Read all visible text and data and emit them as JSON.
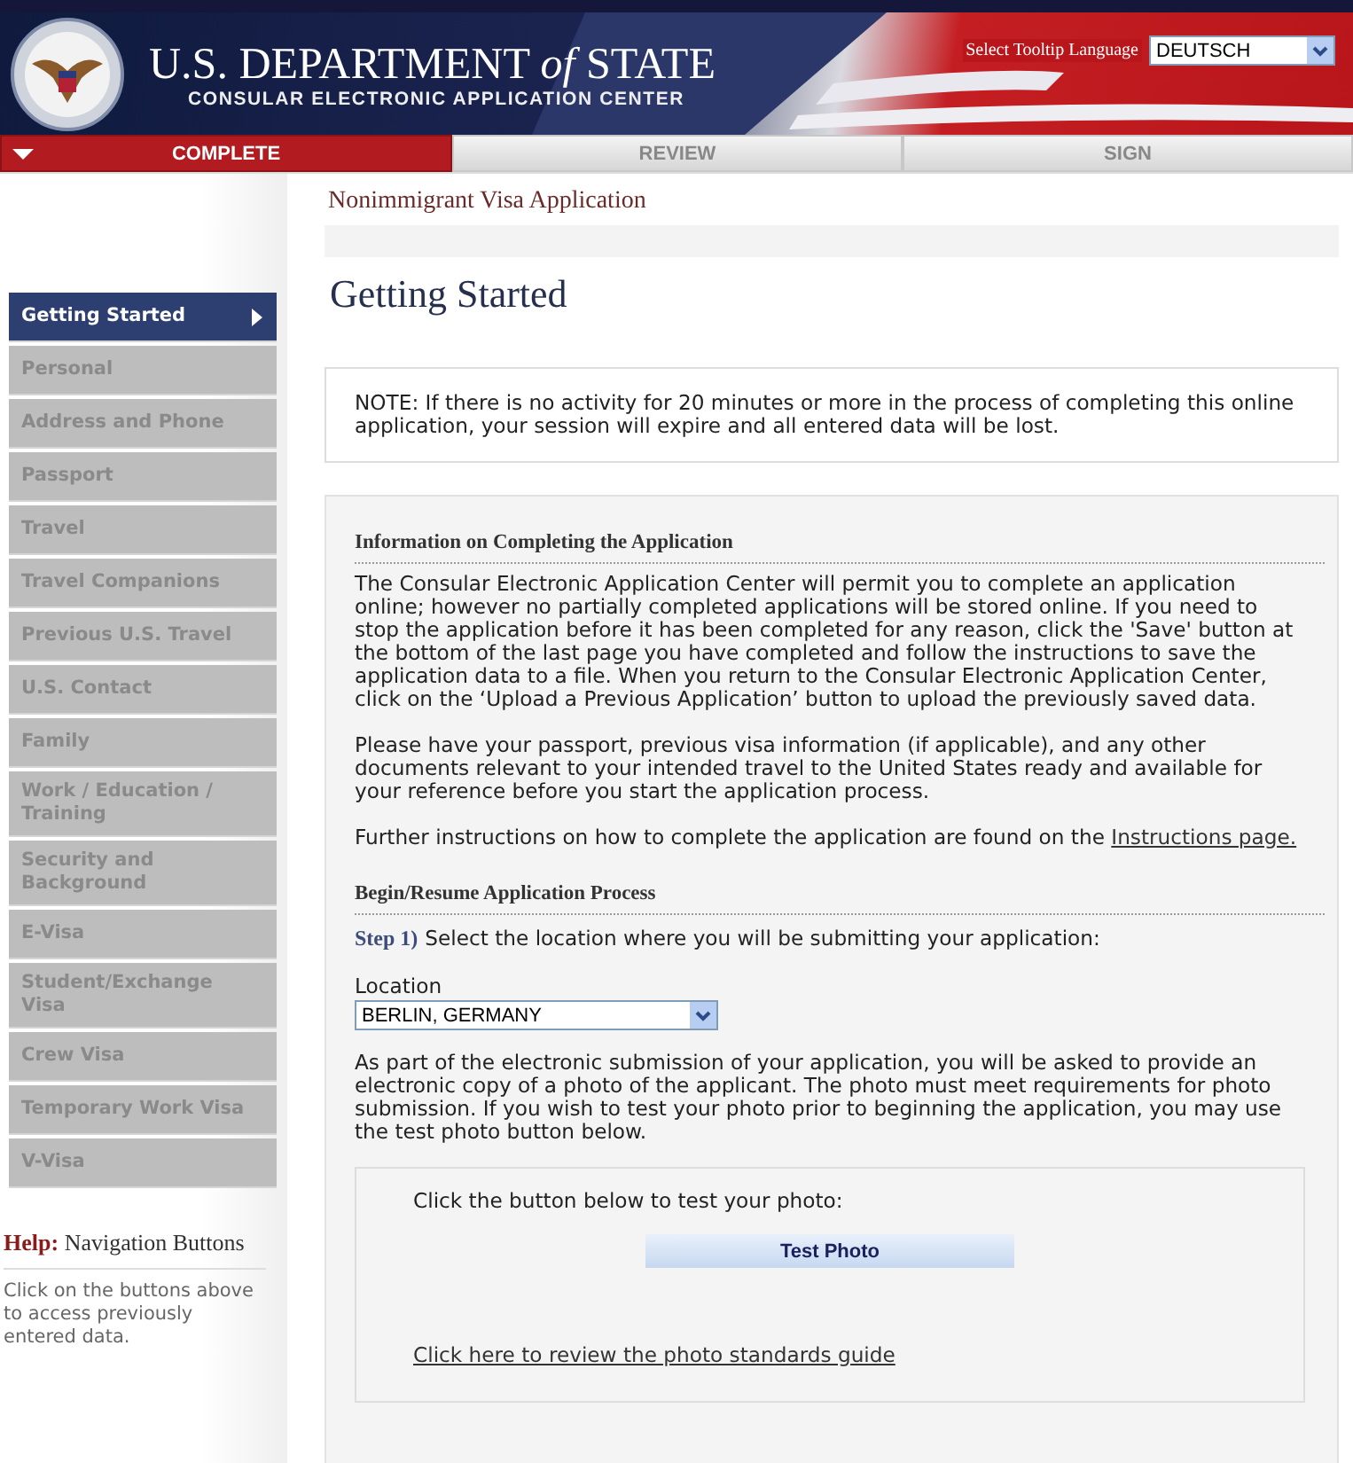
{
  "header": {
    "title": "U.S. DEPARTMENT *of* STATE",
    "subtitle": "CONSULAR ELECTRONIC APPLICATION CENTER",
    "tooltip_language": {
      "label": "Select Tooltip Language",
      "value": "DEUTSCH"
    }
  },
  "tabs": [
    {
      "label": "COMPLETE",
      "selected": true
    },
    {
      "label": "REVIEW",
      "selected": false
    },
    {
      "label": "SIGN",
      "selected": false
    }
  ],
  "sidebar": {
    "items": [
      {
        "label": "Getting Started",
        "selected": true
      },
      {
        "label": "Personal",
        "selected": false
      },
      {
        "label": "Address and Phone",
        "selected": false
      },
      {
        "label": "Passport",
        "selected": false
      },
      {
        "label": "Travel",
        "selected": false
      },
      {
        "label": "Travel Companions",
        "selected": false
      },
      {
        "label": "Previous U.S. Travel",
        "selected": false
      },
      {
        "label": "U.S. Contact",
        "selected": false
      },
      {
        "label": "Family",
        "selected": false
      },
      {
        "label": "Work / Education / Training",
        "selected": false
      },
      {
        "label": "Security and Background",
        "selected": false
      },
      {
        "label": "E-Visa",
        "selected": false
      },
      {
        "label": "Student/Exchange Visa",
        "selected": false
      },
      {
        "label": "Crew Visa",
        "selected": false
      },
      {
        "label": "Temporary Work Visa",
        "selected": false
      },
      {
        "label": "V-Visa",
        "selected": false
      }
    ],
    "help": {
      "title": "**Help:** Navigation Buttons",
      "text": "Click on the buttons above to access previously entered data."
    }
  },
  "breadcrumb": "Nonimmigrant Visa Application",
  "page_title": "Getting Started",
  "note": "NOTE: If there is no activity for 20 minutes or more in the process of completing this online application, your session will expire and all entered data will be lost.",
  "info": {
    "heading": "Information on Completing the Application",
    "paragraphs": [
      "The Consular Electronic Application Center will permit you to complete an application online; however no partially completed applications will be stored online. If you need to stop the application before it has been completed for any reason, click the 'Save' button at the bottom of the last page you have completed and follow the instructions to save the application data to a file. When you return to the Consular Electronic Application Center, click on the ‘Upload a Previous Application’ button to upload the previously saved data.",
      "Please have your passport, previous visa information (if applicable), and any other documents relevant to your intended travel to the United States ready and available for your reference before you start the application process."
    ],
    "further": {
      "text": "Further instructions on how to complete the application are found on the",
      "link": "Instructions page."
    }
  },
  "begin": {
    "heading": "Begin/Resume Application Process",
    "step_label": "Step 1)",
    "step_text": "Select the location where you will be submitting your application:",
    "location": {
      "label": "Location",
      "value": "BERLIN, GERMANY"
    },
    "photo_text": "As part of the electronic submission of your application, you will be asked to provide an electronic copy of a photo of the applicant. The photo must meet requirements for photo submission. If you wish to test your photo prior to beginning the application, you may use the test photo button below.",
    "photo_box": {
      "prompt": "Click the button below to test your photo:",
      "button": "Test Photo",
      "link": "Click here to review the photo standards guide"
    }
  }
}
